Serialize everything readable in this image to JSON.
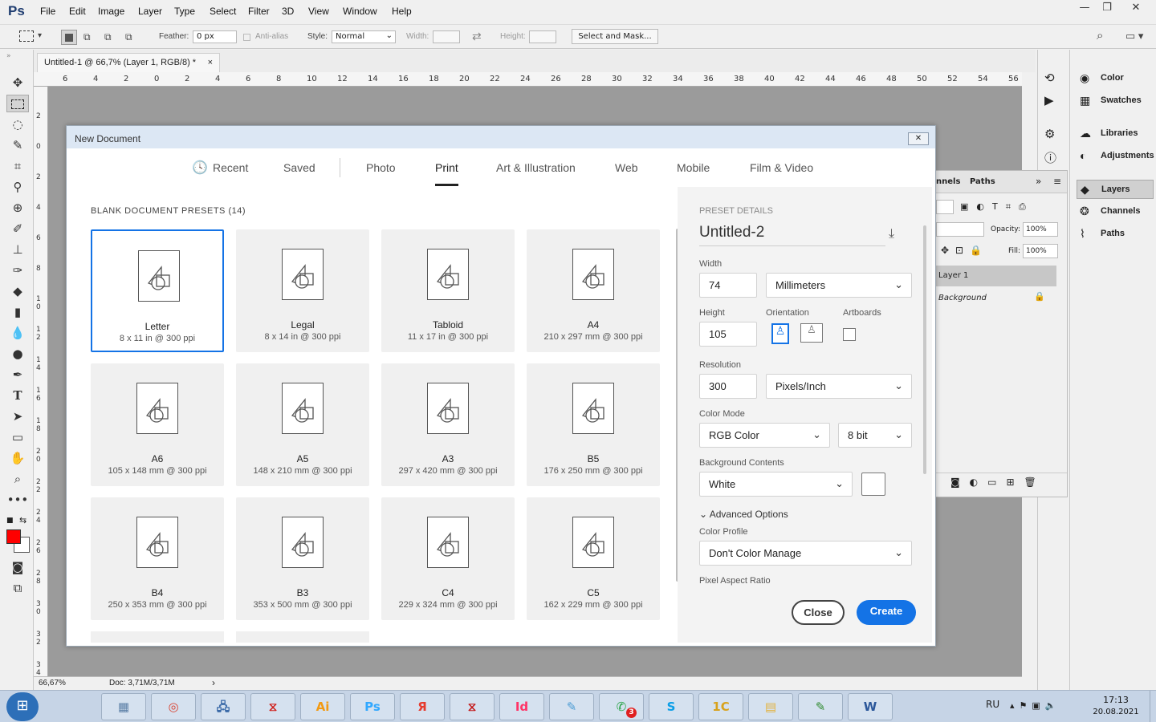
{
  "app": {
    "logo": "Ps"
  },
  "menu": [
    "File",
    "Edit",
    "Image",
    "Layer",
    "Type",
    "Select",
    "Filter",
    "3D",
    "View",
    "Window",
    "Help"
  ],
  "window_controls": {
    "minimize": "—",
    "restore": "❐",
    "close": "✕"
  },
  "options_bar": {
    "feather_label": "Feather:",
    "feather_value": "0 px",
    "antialias_label": "Anti-alias",
    "style_label": "Style:",
    "style_value": "Normal",
    "width_label": "Width:",
    "height_label": "Height:",
    "select_mask_label": "Select and Mask..."
  },
  "document_tab": {
    "title": "Untitled-1 @ 66,7% (Layer 1, RGB/8) *",
    "close": "×"
  },
  "ruler_top_ticks": [
    "6",
    "4",
    "2",
    "0",
    "2",
    "4",
    "6",
    "8",
    "10",
    "12",
    "14",
    "16",
    "18",
    "20",
    "22",
    "24",
    "26",
    "28",
    "30",
    "32",
    "34",
    "36",
    "38",
    "40",
    "42",
    "44",
    "46",
    "48",
    "50",
    "52",
    "54",
    "56"
  ],
  "ruler_left_ticks": [
    "2",
    "0",
    "2",
    "4",
    "6",
    "8",
    "10",
    "12",
    "14",
    "16",
    "18",
    "20",
    "22",
    "24",
    "26",
    "28",
    "30",
    "32",
    "34"
  ],
  "status": {
    "zoom": "66,67%",
    "doc": "Doc: 3,71M/3,71M",
    "arrow": "›"
  },
  "right_panels": [
    {
      "label": "Color",
      "icon": "palette-icon",
      "glyph": "◉"
    },
    {
      "label": "Swatches",
      "icon": "grid-icon",
      "glyph": "▦"
    },
    {
      "label": "Libraries",
      "icon": "cloud-icon",
      "glyph": "☁"
    },
    {
      "label": "Adjustments",
      "icon": "contrast-icon",
      "glyph": "◐"
    },
    {
      "label": "Layers",
      "icon": "layers-icon",
      "glyph": "◆"
    },
    {
      "label": "Channels",
      "icon": "channels-icon",
      "glyph": "❂"
    },
    {
      "label": "Paths",
      "icon": "paths-icon",
      "glyph": "⌇"
    }
  ],
  "layers_panel": {
    "tab_channels": "nnels",
    "tab_paths": "Paths",
    "opacity_label": "Opacity:",
    "opacity_value": "100%",
    "fill_label": "Fill:",
    "fill_value": "100%",
    "layers": [
      "Layer 1",
      "Background"
    ]
  },
  "dialog": {
    "title": "New Document",
    "close_glyph": "✕",
    "tabs": [
      {
        "label": "Recent",
        "active": false
      },
      {
        "label": "Saved",
        "active": false
      },
      {
        "label": "Photo",
        "active": false
      },
      {
        "label": "Print",
        "active": true
      },
      {
        "label": "Art & Illustration",
        "active": false
      },
      {
        "label": "Web",
        "active": false
      },
      {
        "label": "Mobile",
        "active": false
      },
      {
        "label": "Film & Video",
        "active": false
      }
    ],
    "presets_heading": "BLANK DOCUMENT PRESETS (14)",
    "presets": [
      {
        "name": "Letter",
        "dims": "8 x 11 in @ 300 ppi",
        "selected": true
      },
      {
        "name": "Legal",
        "dims": "8 x 14 in @ 300 ppi",
        "selected": false
      },
      {
        "name": "Tabloid",
        "dims": "11 x 17 in @ 300 ppi",
        "selected": false
      },
      {
        "name": "A4",
        "dims": "210 x 297 mm @ 300 ppi",
        "selected": false
      },
      {
        "name": "A6",
        "dims": "105 x 148 mm @ 300 ppi",
        "selected": false
      },
      {
        "name": "A5",
        "dims": "148 x 210 mm @ 300 ppi",
        "selected": false
      },
      {
        "name": "A3",
        "dims": "297 x 420 mm @ 300 ppi",
        "selected": false
      },
      {
        "name": "B5",
        "dims": "176 x 250 mm @ 300 ppi",
        "selected": false
      },
      {
        "name": "B4",
        "dims": "250 x 353 mm @ 300 ppi",
        "selected": false
      },
      {
        "name": "B3",
        "dims": "353 x 500 mm @ 300 ppi",
        "selected": false
      },
      {
        "name": "C4",
        "dims": "229 x 324 mm @ 300 ppi",
        "selected": false
      },
      {
        "name": "C5",
        "dims": "162 x 229 mm @ 300 ppi",
        "selected": false
      }
    ],
    "details": {
      "heading": "PRESET DETAILS",
      "doc_name": "Untitled-2",
      "width_label": "Width",
      "width_value": "74",
      "width_unit": "Millimeters",
      "height_label": "Height",
      "height_value": "105",
      "orientation_label": "Orientation",
      "artboards_label": "Artboards",
      "resolution_label": "Resolution",
      "resolution_value": "300",
      "resolution_unit": "Pixels/Inch",
      "color_mode_label": "Color Mode",
      "color_mode_value": "RGB Color",
      "bit_depth": "8 bit",
      "bg_label": "Background Contents",
      "bg_value": "White",
      "advanced_label": "Advanced Options",
      "profile_label": "Color Profile",
      "profile_value": "Don't Color Manage",
      "pixel_ratio_label": "Pixel Aspect Ratio",
      "close_label": "Close",
      "create_label": "Create"
    }
  },
  "taskbar": {
    "apps": [
      {
        "name": "calculator",
        "glyph": "▦",
        "color": "#5b7fa6"
      },
      {
        "name": "chrome",
        "glyph": "◎",
        "color": "#d9412f"
      },
      {
        "name": "network",
        "glyph": "🖧",
        "color": "#3b6aa8"
      },
      {
        "name": "acrobat",
        "glyph": "⧖",
        "color": "#d0201c"
      },
      {
        "name": "illustrator",
        "glyph": "Ai",
        "color": "#f29a13"
      },
      {
        "name": "photoshop",
        "glyph": "Ps",
        "color": "#31a8ff"
      },
      {
        "name": "yandex",
        "glyph": "Я",
        "color": "#e63b2e"
      },
      {
        "name": "acrobat-dc",
        "glyph": "⧖",
        "color": "#c41718"
      },
      {
        "name": "indesign",
        "glyph": "Id",
        "color": "#ff3366"
      },
      {
        "name": "notepad",
        "glyph": "✎",
        "color": "#4a9bd3"
      },
      {
        "name": "whatsapp",
        "glyph": "✆",
        "color": "#25a244"
      },
      {
        "name": "skype",
        "glyph": "S",
        "color": "#0b9ee7"
      },
      {
        "name": "1c",
        "glyph": "1C",
        "color": "#d8a21c"
      },
      {
        "name": "explorer",
        "glyph": "▤",
        "color": "#e3b23c"
      },
      {
        "name": "ccleaner",
        "glyph": "✎",
        "color": "#2f8a2f"
      },
      {
        "name": "word",
        "glyph": "W",
        "color": "#2b579a"
      }
    ],
    "badge": "3",
    "lang": "RU",
    "time": "17:13",
    "date": "20.08.2021"
  }
}
